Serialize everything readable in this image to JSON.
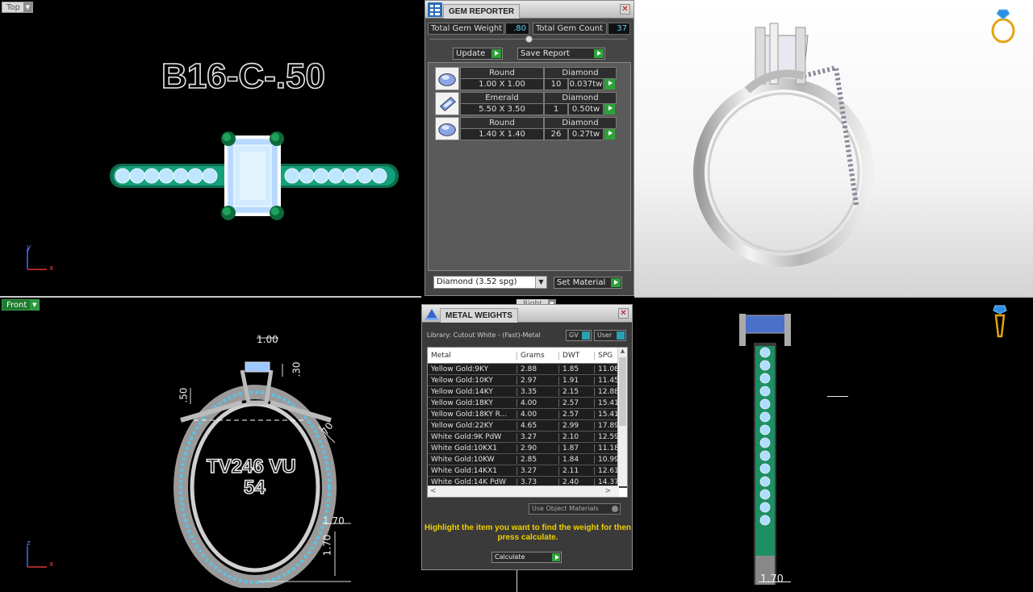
{
  "viewports": {
    "top": {
      "label": "Top",
      "model_title": "B16-C-.50",
      "axis_y": "y",
      "axis_x": "x"
    },
    "front": {
      "label": "Front",
      "engraving_line1": "TV246 VU",
      "engraving_line2": "54",
      "axis_z": "z",
      "axis_x": "x",
      "dims": {
        "d1": "1.00",
        "d2": ".30",
        "d3": ".50",
        "d4": ".70",
        "d5": "1.70",
        "d6": "1.70"
      }
    },
    "right": {
      "label": "Right",
      "dim": "1.70"
    },
    "perspective": {
      "label": ""
    }
  },
  "gem_reporter": {
    "title": "GEM REPORTER",
    "total_weight_label": "Total Gem Weight",
    "total_weight_value": ".80",
    "total_count_label": "Total Gem Count",
    "total_count_value": "37",
    "update_label": "Update",
    "save_report_label": "Save Report",
    "gems": [
      {
        "shape": "Round",
        "size": "1.00 X 1.00",
        "material": "Diamond",
        "count": "10",
        "weight": "0.037tw"
      },
      {
        "shape": "Emerald",
        "size": "5.50 X 3.50",
        "material": "Diamond",
        "count": "1",
        "weight": "0.50tw"
      },
      {
        "shape": "Round",
        "size": "1.40 X 1.40",
        "material": "Diamond",
        "count": "26",
        "weight": "0.27tw"
      }
    ],
    "material_select": "Diamond      (3.52 spg)",
    "set_material_label": "Set Material"
  },
  "metal_weights": {
    "title": "METAL WEIGHTS",
    "library": "Library: Cutout White - (Fast)-Metal",
    "gv_label": "GV",
    "user_label": "User",
    "columns": [
      "Metal",
      "Grams",
      "DWT",
      "SPG"
    ],
    "rows": [
      [
        "Yellow Gold:9KY",
        "2.88",
        "1.85",
        "11.08"
      ],
      [
        "Yellow Gold:10KY",
        "2.97",
        "1.91",
        "11.45"
      ],
      [
        "Yellow Gold:14KY",
        "3.35",
        "2.15",
        "12.88"
      ],
      [
        "Yellow Gold:18KY",
        "4.00",
        "2.57",
        "15.41"
      ],
      [
        "Yellow Gold:18KY R...",
        "4.00",
        "2.57",
        "15.41"
      ],
      [
        "Yellow Gold:22KY",
        "4.65",
        "2.99",
        "17.89"
      ],
      [
        "White Gold:9K PdW",
        "3.27",
        "2.10",
        "12.59"
      ],
      [
        "White Gold:10KX1",
        "2.90",
        "1.87",
        "11.18"
      ],
      [
        "White Gold:10KW",
        "2.85",
        "1.84",
        "10.99"
      ],
      [
        "White Gold:14KX1",
        "3.27",
        "2.11",
        "12.61"
      ],
      [
        "White Gold:14K PdW",
        "3.73",
        "2.40",
        "14.37"
      ]
    ],
    "use_object_materials": "Use Object Materials",
    "hint": "Highlight the item you want to find the weight for then press calculate.",
    "calculate_label": "Calculate"
  }
}
